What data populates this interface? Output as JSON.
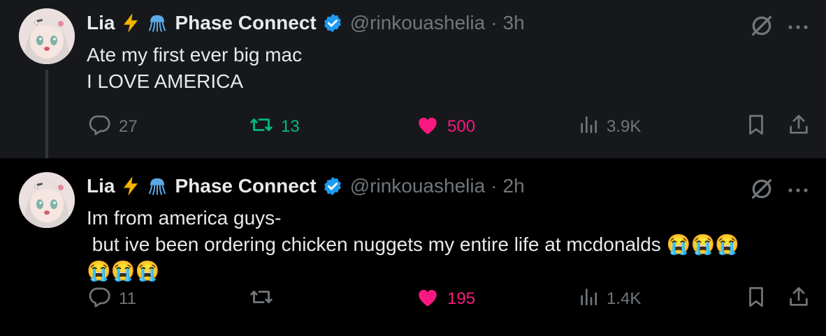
{
  "colors": {
    "accent_blue": "#1d9bf0",
    "retweet_green": "#00ba7c",
    "like_pink": "#f91880",
    "muted": "#71767b"
  },
  "tweets": [
    {
      "author": {
        "name": "Lia",
        "affiliation": "Phase Connect",
        "handle": "@rinkouashelia",
        "separator": "·",
        "time": "3h",
        "icons": [
          "lightning-emoji",
          "jellyfish-emoji",
          "verified-badge"
        ]
      },
      "lines": [
        "Ate my first ever big mac",
        "I LOVE AMERICA"
      ],
      "stats": {
        "replies": "27",
        "retweets": "13",
        "likes": "500",
        "views": "3.9K"
      },
      "retweeted": true,
      "liked": true
    },
    {
      "author": {
        "name": "Lia",
        "affiliation": "Phase Connect",
        "handle": "@rinkouashelia",
        "separator": "·",
        "time": "2h",
        "icons": [
          "lightning-emoji",
          "jellyfish-emoji",
          "verified-badge"
        ]
      },
      "lines": [
        "Im from america guys-",
        " but ive been ordering chicken nuggets my entire life at mcdonalds 😭😭😭",
        "😭😭😭"
      ],
      "stats": {
        "replies": "11",
        "retweets": "",
        "likes": "195",
        "views": "1.4K"
      },
      "retweeted": false,
      "liked": true
    }
  ]
}
